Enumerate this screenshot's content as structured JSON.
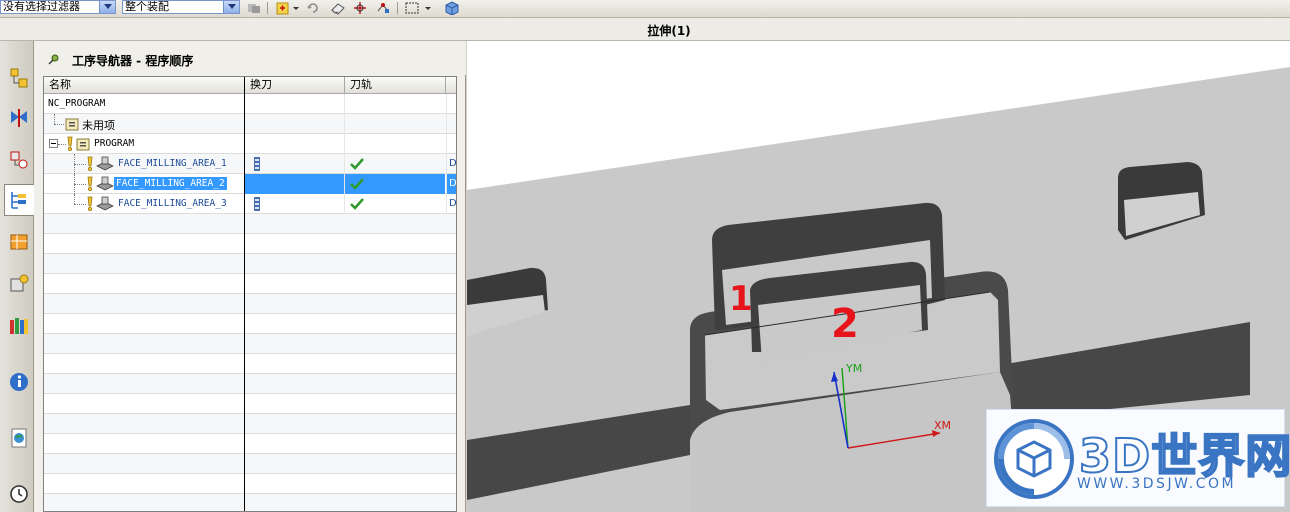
{
  "toolbar": {
    "filter_combo_value": "没有选择过滤器",
    "assembly_combo_value": "整个装配"
  },
  "view": {
    "title": "拉伸(1)"
  },
  "navigator": {
    "title": "工序导航器 - 程序顺序",
    "columns": [
      "名称",
      "换刀",
      "刀轨"
    ],
    "rows": [
      {
        "name": "NC_PROGRAM"
      },
      {
        "name": "未用项"
      },
      {
        "name": "PROGRAM"
      },
      {
        "name": "FACE_MILLING_AREA_1",
        "path_ok": true,
        "extra": "D"
      },
      {
        "name": "FACE_MILLING_AREA_2",
        "path_ok": true,
        "extra": "D"
      },
      {
        "name": "FACE_MILLING_AREA_3",
        "path_ok": true,
        "extra": "D"
      }
    ]
  },
  "viewport": {
    "annotation_1": "1",
    "annotation_2": "2",
    "axis_x": "XM",
    "axis_y": "YM"
  },
  "watermark": {
    "logo": "3D世界网",
    "url": "WWW.3DSJW.COM"
  },
  "colors": {
    "selection": "#3399ff",
    "model_face": "#c9c9c9",
    "model_wall": "#4a4a4a",
    "annotation": "#e8141b"
  }
}
